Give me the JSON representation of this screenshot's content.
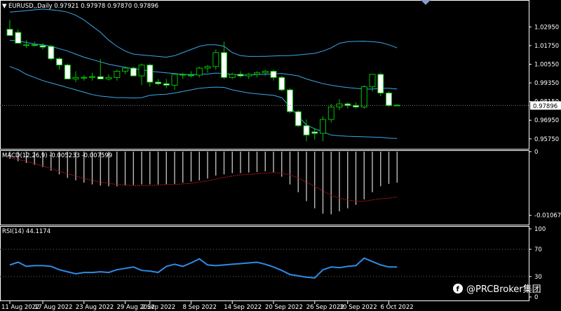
{
  "symbol_header": "EURUSD,,Daily  0.97921 0.97978 0.97870 0.97896",
  "watermark": "@PRCBroker集团",
  "colors": {
    "background": "#000000",
    "grid_border": "#ffffff",
    "bull_candle": "#000000",
    "bear_candle": "#ffffff",
    "candle_wick": "#00c000",
    "bands": "#3aa8e8",
    "macd_hist": "#c8c8c8",
    "macd_signal": "#b01818",
    "rsi_line": "#2e8be6",
    "price_marker": "#ffffff"
  },
  "chart_data": [
    {
      "type": "candlestick",
      "title": "EURUSD,,Daily  0.97921 0.97978 0.97870 0.97896",
      "ylim": [
        0.952,
        1.045
      ],
      "y_ticks": [
        "1.02950",
        "1.01750",
        "1.00550",
        "0.99350",
        "0.98150",
        "0.96950",
        "0.95750"
      ],
      "current_price": "0.97896",
      "candles": [
        {
          "o": 1.028,
          "h": 1.034,
          "l": 1.024,
          "c": 1.024
        },
        {
          "o": 1.026,
          "h": 1.028,
          "l": 1.019,
          "c": 1.019
        },
        {
          "o": 1.018,
          "h": 1.021,
          "l": 1.016,
          "c": 1.018
        },
        {
          "o": 1.018,
          "h": 1.02,
          "l": 1.017,
          "c": 1.0175
        },
        {
          "o": 1.0175,
          "h": 1.019,
          "l": 1.015,
          "c": 1.0165
        },
        {
          "o": 1.017,
          "h": 1.018,
          "l": 1.008,
          "c": 1.009
        },
        {
          "o": 1.009,
          "h": 1.01,
          "l": 1.002,
          "c": 1.005
        },
        {
          "o": 1.005,
          "h": 1.006,
          "l": 0.996,
          "c": 0.996
        },
        {
          "o": 0.996,
          "h": 1.001,
          "l": 0.994,
          "c": 0.997
        },
        {
          "o": 0.997,
          "h": 0.9985,
          "l": 0.995,
          "c": 0.997
        },
        {
          "o": 0.997,
          "h": 1.0,
          "l": 0.995,
          "c": 0.9975
        },
        {
          "o": 0.9975,
          "h": 1.009,
          "l": 0.996,
          "c": 0.996
        },
        {
          "o": 0.996,
          "h": 0.999,
          "l": 0.995,
          "c": 0.997
        },
        {
          "o": 0.997,
          "h": 1.002,
          "l": 0.995,
          "c": 1.001
        },
        {
          "o": 1.001,
          "h": 1.004,
          "l": 0.999,
          "c": 1.003
        },
        {
          "o": 1.003,
          "h": 1.004,
          "l": 0.998,
          "c": 0.998
        },
        {
          "o": 0.998,
          "h": 1.006,
          "l": 0.992,
          "c": 1.005
        },
        {
          "o": 1.005,
          "h": 1.006,
          "l": 0.991,
          "c": 0.994
        },
        {
          "o": 0.994,
          "h": 0.996,
          "l": 0.992,
          "c": 0.993
        },
        {
          "o": 0.993,
          "h": 0.996,
          "l": 0.99,
          "c": 0.992
        },
        {
          "o": 0.992,
          "h": 0.999,
          "l": 0.989,
          "c": 0.999
        },
        {
          "o": 0.999,
          "h": 1.0,
          "l": 0.996,
          "c": 0.9985
        },
        {
          "o": 0.9985,
          "h": 1.001,
          "l": 0.997,
          "c": 0.9985
        },
        {
          "o": 0.9985,
          "h": 1.004,
          "l": 0.997,
          "c": 1.003
        },
        {
          "o": 1.003,
          "h": 1.005,
          "l": 1.0,
          "c": 1.004
        },
        {
          "o": 1.004,
          "h": 1.015,
          "l": 1.002,
          "c": 1.013
        },
        {
          "o": 1.013,
          "h": 1.02,
          "l": 0.996,
          "c": 0.997
        },
        {
          "o": 0.997,
          "h": 1.0,
          "l": 0.996,
          "c": 0.999
        },
        {
          "o": 0.999,
          "h": 1.001,
          "l": 0.997,
          "c": 0.998
        },
        {
          "o": 0.998,
          "h": 1.0,
          "l": 0.996,
          "c": 0.999
        },
        {
          "o": 0.999,
          "h": 1.001,
          "l": 0.997,
          "c": 1.0
        },
        {
          "o": 1.0,
          "h": 1.002,
          "l": 0.998,
          "c": 1.001
        },
        {
          "o": 1.001,
          "h": 1.002,
          "l": 0.995,
          "c": 0.997
        },
        {
          "o": 0.997,
          "h": 0.998,
          "l": 0.988,
          "c": 0.989
        },
        {
          "o": 0.989,
          "h": 0.99,
          "l": 0.974,
          "c": 0.975
        },
        {
          "o": 0.975,
          "h": 0.976,
          "l": 0.965,
          "c": 0.966
        },
        {
          "o": 0.966,
          "h": 0.97,
          "l": 0.956,
          "c": 0.96
        },
        {
          "o": 0.962,
          "h": 0.964,
          "l": 0.957,
          "c": 0.961
        },
        {
          "o": 0.961,
          "h": 0.972,
          "l": 0.956,
          "c": 0.97
        },
        {
          "o": 0.97,
          "h": 0.98,
          "l": 0.968,
          "c": 0.978
        },
        {
          "o": 0.978,
          "h": 0.983,
          "l": 0.976,
          "c": 0.98
        },
        {
          "o": 0.98,
          "h": 0.981,
          "l": 0.977,
          "c": 0.979
        },
        {
          "o": 0.979,
          "h": 0.981,
          "l": 0.977,
          "c": 0.978
        },
        {
          "o": 0.978,
          "h": 0.992,
          "l": 0.977,
          "c": 0.991
        },
        {
          "o": 0.991,
          "h": 0.999,
          "l": 0.988,
          "c": 0.999
        },
        {
          "o": 0.999,
          "h": 1.0,
          "l": 0.985,
          "c": 0.987
        },
        {
          "o": 0.987,
          "h": 0.988,
          "l": 0.978,
          "c": 0.979
        },
        {
          "o": 0.9792,
          "h": 0.9798,
          "l": 0.9787,
          "c": 0.97896
        }
      ],
      "bollinger_upper": [
        1.039,
        1.0395,
        1.04,
        1.0405,
        1.041,
        1.0405,
        1.04,
        1.039,
        1.037,
        1.034,
        1.03,
        1.026,
        1.021,
        1.017,
        1.014,
        1.012,
        1.0115,
        1.011,
        1.0105,
        1.01,
        1.011,
        1.013,
        1.015,
        1.017,
        1.018,
        1.018,
        1.017,
        1.013,
        1.011,
        1.0105,
        1.0105,
        1.0106,
        1.0108,
        1.011,
        1.011,
        1.0115,
        1.012,
        1.0125,
        1.014,
        1.016,
        1.019,
        1.02,
        1.0202,
        1.0203,
        1.02,
        1.0195,
        1.018,
        1.016
      ],
      "bollinger_middle": [
        1.021,
        1.0205,
        1.0195,
        1.0185,
        1.018,
        1.017,
        1.0155,
        1.014,
        1.012,
        1.01,
        1.0085,
        1.007,
        1.0055,
        1.0045,
        1.0035,
        1.0025,
        1.002,
        1.001,
        1.0005,
        1.0,
        0.9995,
        0.999,
        0.9988,
        0.999,
        0.9992,
        0.9998,
        0.9995,
        0.999,
        0.9985,
        0.9985,
        0.9988,
        0.999,
        0.9993,
        0.9995,
        0.9988,
        0.998,
        0.996,
        0.9945,
        0.993,
        0.992,
        0.9912,
        0.9905,
        0.99,
        0.9895,
        0.9895,
        0.99,
        0.99,
        0.9895
      ],
      "bollinger_lower": [
        1.004,
        1.002,
        0.999,
        0.997,
        0.995,
        0.9935,
        0.992,
        0.9905,
        0.989,
        0.9875,
        0.986,
        0.985,
        0.9845,
        0.984,
        0.984,
        0.9838,
        0.984,
        0.9855,
        0.986,
        0.9862,
        0.987,
        0.988,
        0.989,
        0.99,
        0.9905,
        0.9908,
        0.9906,
        0.989,
        0.988,
        0.987,
        0.9865,
        0.986,
        0.9855,
        0.984,
        0.978,
        0.972,
        0.9665,
        0.964,
        0.962,
        0.96,
        0.9595,
        0.9592,
        0.959,
        0.9588,
        0.9587,
        0.9585,
        0.958,
        0.9578
      ]
    },
    {
      "type": "bar",
      "title": "MACD(12,26,9) -0.005233 -0.007599",
      "ylim": [
        -0.012,
        0.0
      ],
      "y_ticks": [
        "0",
        "-0.01067"
      ],
      "histogram": [
        -0.0012,
        -0.0016,
        -0.0019,
        -0.0022,
        -0.0026,
        -0.0032,
        -0.0038,
        -0.0044,
        -0.0048,
        -0.0052,
        -0.0055,
        -0.0057,
        -0.0058,
        -0.0058,
        -0.0057,
        -0.0056,
        -0.0055,
        -0.0055,
        -0.0055,
        -0.0055,
        -0.0054,
        -0.0052,
        -0.005,
        -0.0048,
        -0.0045,
        -0.004,
        -0.0038,
        -0.0036,
        -0.0036,
        -0.0035,
        -0.0034,
        -0.0033,
        -0.0035,
        -0.0042,
        -0.0055,
        -0.0068,
        -0.0083,
        -0.0095,
        -0.0104,
        -0.0105,
        -0.01,
        -0.0095,
        -0.0089,
        -0.008,
        -0.0068,
        -0.0058,
        -0.0054,
        -0.0052
      ],
      "signal": [
        -0.001,
        -0.0013,
        -0.0016,
        -0.002,
        -0.0024,
        -0.0028,
        -0.0033,
        -0.0037,
        -0.0041,
        -0.0045,
        -0.0048,
        -0.0051,
        -0.0053,
        -0.0055,
        -0.0056,
        -0.0057,
        -0.0057,
        -0.0057,
        -0.0056,
        -0.0055,
        -0.0055,
        -0.0054,
        -0.0053,
        -0.0051,
        -0.0049,
        -0.0046,
        -0.0043,
        -0.0041,
        -0.0039,
        -0.0038,
        -0.0037,
        -0.0036,
        -0.0035,
        -0.0036,
        -0.0039,
        -0.0044,
        -0.0051,
        -0.0058,
        -0.0066,
        -0.0073,
        -0.0078,
        -0.0081,
        -0.0083,
        -0.0083,
        -0.0081,
        -0.0079,
        -0.0078,
        -0.0076
      ]
    },
    {
      "type": "line",
      "title": "RSI(14) 44.1174",
      "ylim": [
        0,
        100
      ],
      "y_ticks": [
        "100",
        "70",
        "30",
        "0"
      ],
      "values": [
        47,
        51,
        45,
        46,
        46,
        45,
        40,
        37,
        34,
        36,
        36,
        37,
        36,
        40,
        42,
        44,
        39,
        38,
        36,
        45,
        48,
        45,
        50,
        56,
        47,
        46,
        47,
        48,
        49,
        50,
        51,
        48,
        44,
        39,
        33,
        31,
        29,
        28,
        40,
        44,
        43,
        45,
        46,
        57,
        52,
        47,
        44,
        44
      ]
    }
  ],
  "x_axis_labels": [
    "11 Aug 2022",
    "17 Aug 2022",
    "23 Aug 2022",
    "29 Aug 2022",
    "2 Sep 2022",
    "8 Sep 2022",
    "14 Sep 2022",
    "20 Sep 2022",
    "26 Sep 2022",
    "30 Sep 2022",
    "6 Oct 2022"
  ]
}
